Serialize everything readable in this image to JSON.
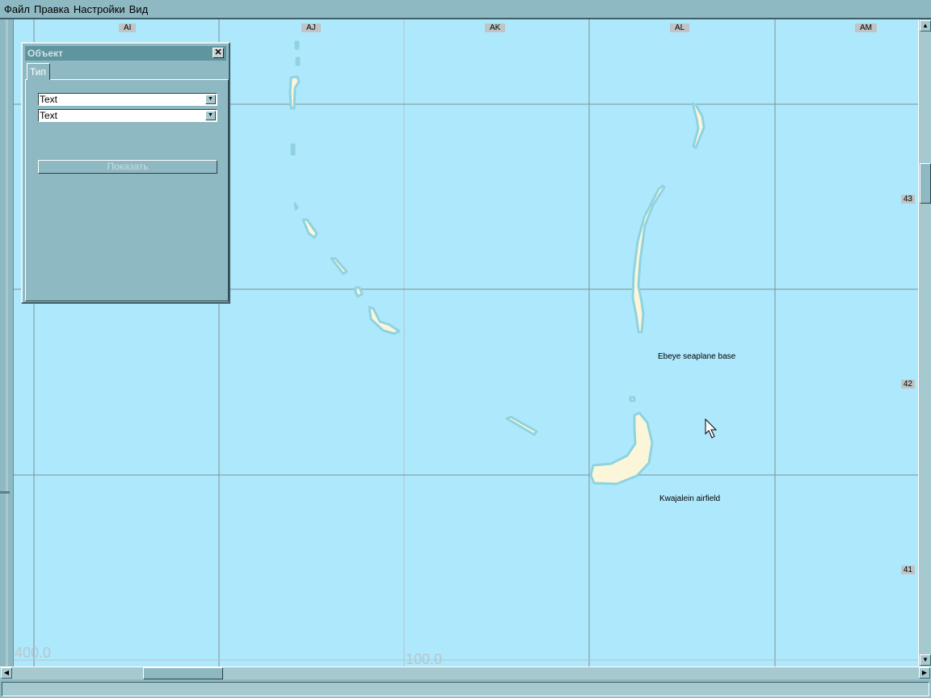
{
  "menu": [
    "Файл",
    "Правка",
    "Настройки",
    "Вид"
  ],
  "map": {
    "columns": [
      "AI",
      "AJ",
      "AK",
      "AL",
      "AM"
    ],
    "rows": [
      "43",
      "42",
      "41"
    ],
    "labels": {
      "ebeye": "Ebeye seaplane base",
      "kwajalein": "Kwajalein airfield"
    },
    "coords": {
      "left": "400.0",
      "bottom": "100.0"
    }
  },
  "panel": {
    "title": "Объект",
    "tab": "Тип",
    "combo1": "Text",
    "combo2": "Text",
    "show_button": "Показать"
  }
}
